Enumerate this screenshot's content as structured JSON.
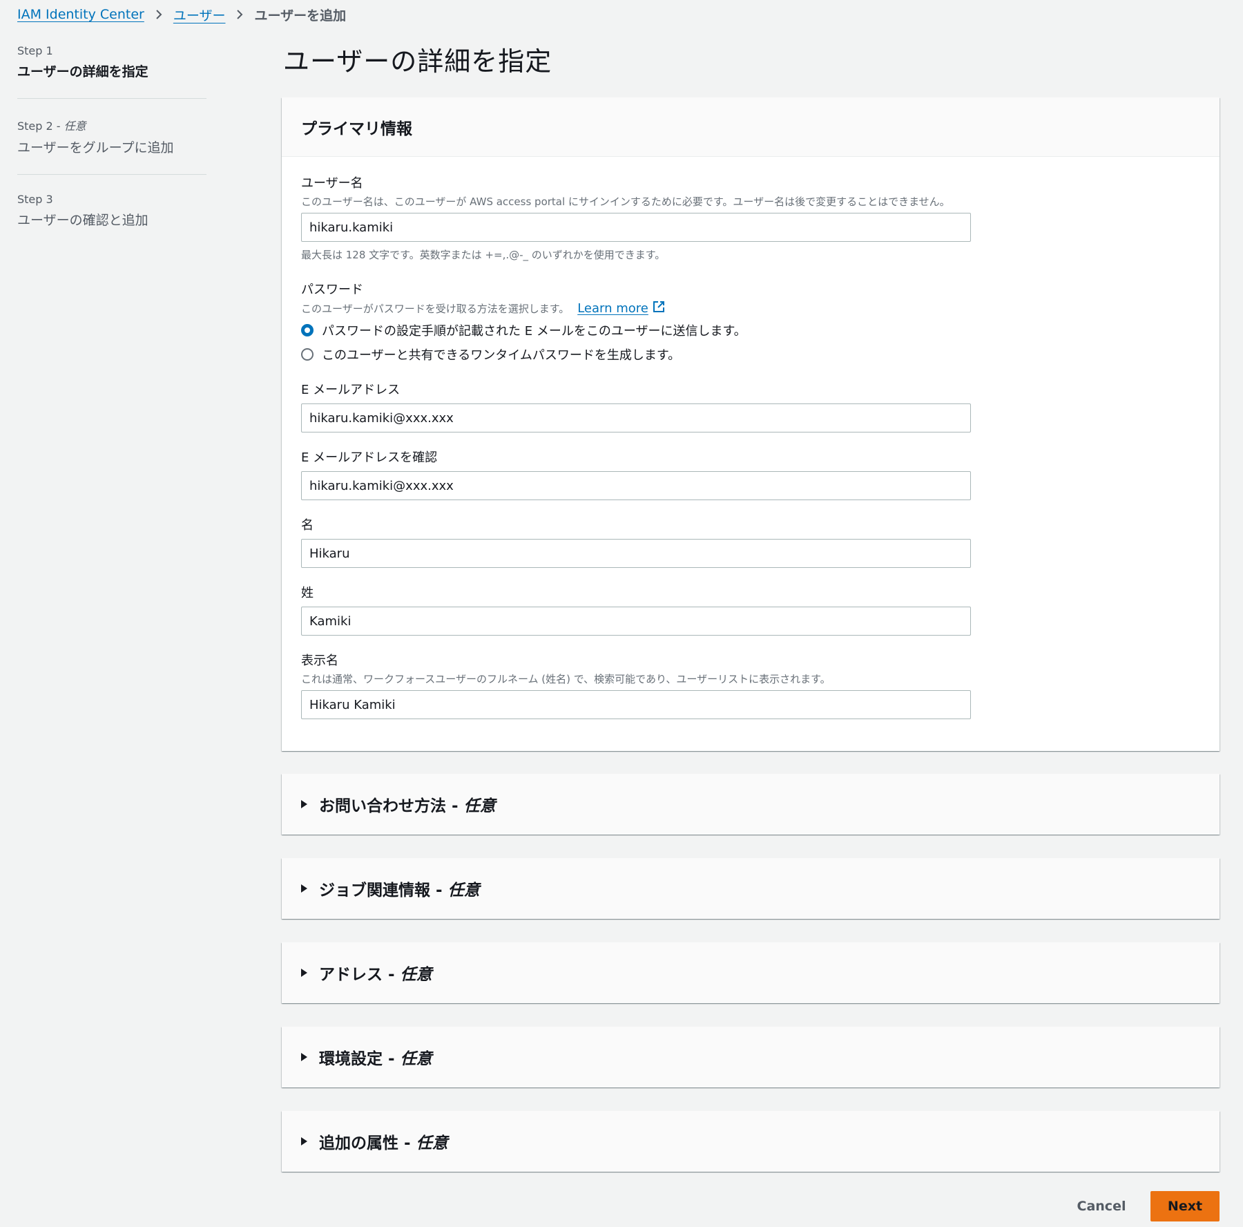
{
  "breadcrumb": {
    "items": [
      "IAM Identity Center",
      "ユーザー"
    ],
    "current": "ユーザーを追加"
  },
  "steps": [
    {
      "num": "Step 1",
      "optional": "",
      "title": "ユーザーの詳細を指定"
    },
    {
      "num": "Step 2 - ",
      "optional": "任意",
      "title": "ユーザーをグループに追加"
    },
    {
      "num": "Step 3",
      "optional": "",
      "title": "ユーザーの確認と追加"
    }
  ],
  "page_title": "ユーザーの詳細を指定",
  "primary": {
    "header": "プライマリ情報",
    "username": {
      "label": "ユーザー名",
      "description": "このユーザー名は、このユーザーが AWS access portal にサインインするために必要です。ユーザー名は後で変更することはできません。",
      "value": "hikaru.kamiki",
      "constraint": "最大長は 128 文字です。英数字または +=,.@-_ のいずれかを使用できます。"
    },
    "password": {
      "label": "パスワード",
      "description": "このユーザーがパスワードを受け取る方法を選択します。",
      "learn_more": "Learn more",
      "options": [
        "パスワードの設定手順が記載された E メールをこのユーザーに送信します。",
        "このユーザーと共有できるワンタイムパスワードを生成します。"
      ],
      "selected_index": 0
    },
    "email": {
      "label": "E メールアドレス",
      "value": "hikaru.kamiki@xxx.xxx"
    },
    "email_confirm": {
      "label": "E メールアドレスを確認",
      "value": "hikaru.kamiki@xxx.xxx"
    },
    "first_name": {
      "label": "名",
      "value": "Hikaru"
    },
    "last_name": {
      "label": "姓",
      "value": "Kamiki"
    },
    "display_name": {
      "label": "表示名",
      "description": "これは通常、ワークフォースユーザーのフルネーム (姓名) で、検索可能であり、ユーザーリストに表示されます。",
      "value": "Hikaru Kamiki"
    }
  },
  "sections": [
    {
      "title": "お問い合わせ方法 - ",
      "optional": "任意"
    },
    {
      "title": "ジョブ関連情報 - ",
      "optional": "任意"
    },
    {
      "title": "アドレス - ",
      "optional": "任意"
    },
    {
      "title": "環境設定 - ",
      "optional": "任意"
    },
    {
      "title": "追加の属性 - ",
      "optional": "任意"
    }
  ],
  "footer": {
    "cancel": "Cancel",
    "next": "Next"
  },
  "colors": {
    "link": "#0073bb",
    "primary_button": "#ec7211",
    "background": "#f2f3f3"
  }
}
